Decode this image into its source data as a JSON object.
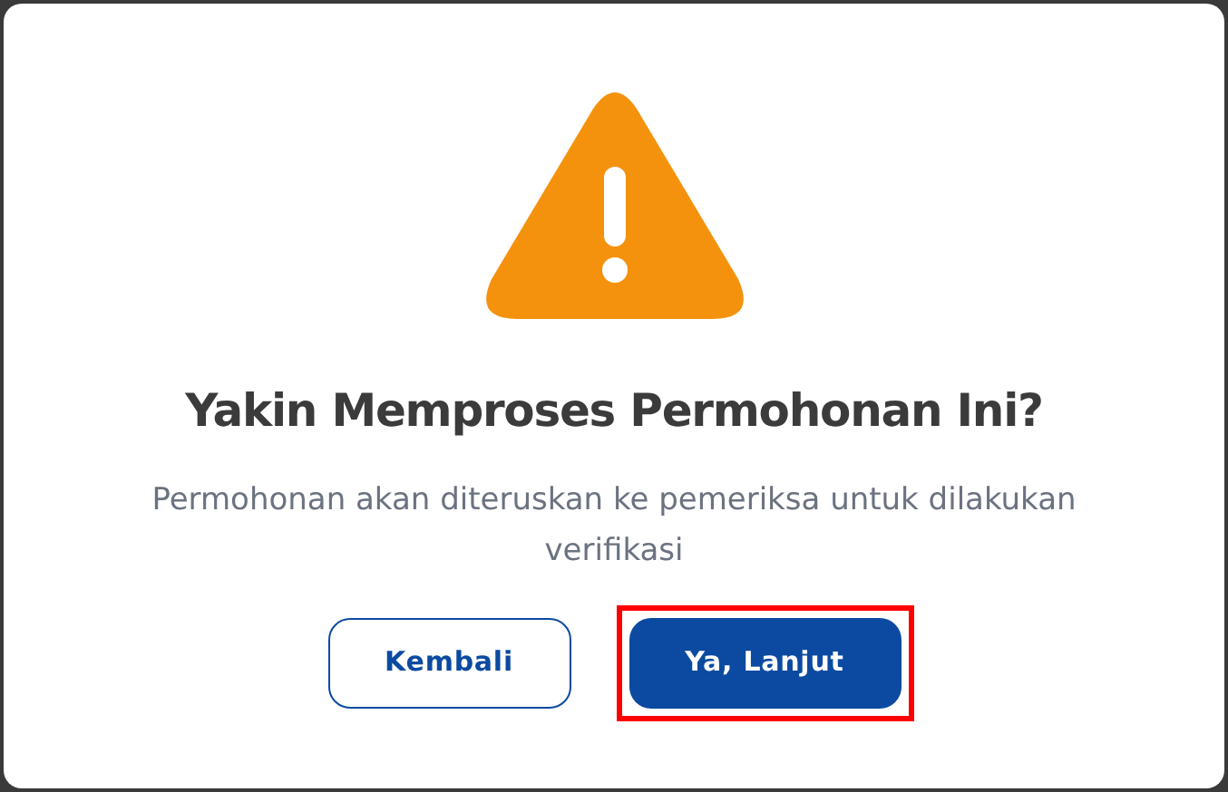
{
  "dialog": {
    "title": "Yakin Memproses Permohonan Ini?",
    "message": "Permohonan akan diteruskan ke pemeriksa untuk dilakukan verifikasi",
    "buttons": [
      {
        "label": "Kembali",
        "kind": "outline",
        "highlighted": false
      },
      {
        "label": "Ya, Lanjut",
        "kind": "primary",
        "highlighted": true
      }
    ]
  }
}
